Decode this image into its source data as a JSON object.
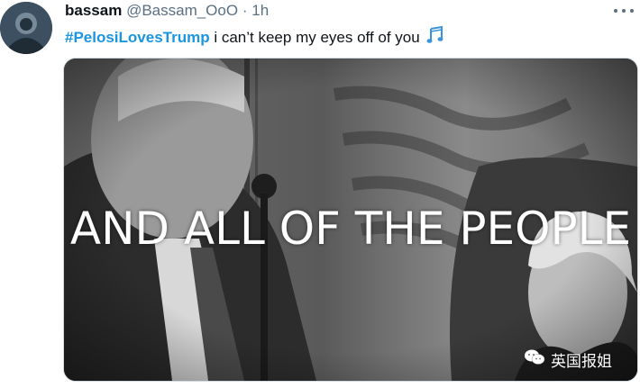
{
  "tweet": {
    "display_name": "bassam",
    "handle": "@Bassam_OoO",
    "separator": "·",
    "time": "1h",
    "hashtag": "#PelosiLovesTrump",
    "body": " i can’t keep my eyes off of you ",
    "emoji_icon": "musical-notes-icon",
    "more_icon": "more-options-icon"
  },
  "media": {
    "caption": "AND ALL OF THE PEOPLE",
    "watermark_text": "英国报姐",
    "watermark_icon": "wechat-icon"
  },
  "colors": {
    "hashtag": "#1b95e0",
    "name": "#0f1419",
    "secondary": "#5b7083",
    "border": "#cfd9de"
  }
}
